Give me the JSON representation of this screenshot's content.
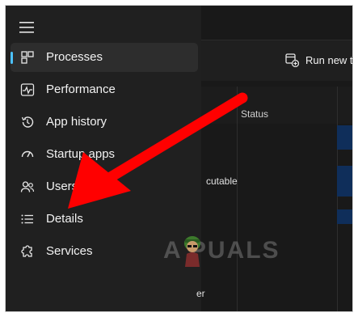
{
  "sidebar": {
    "items": [
      {
        "label": "Processes",
        "icon": "processes-icon",
        "active": true
      },
      {
        "label": "Performance",
        "icon": "performance-icon"
      },
      {
        "label": "App history",
        "icon": "history-icon"
      },
      {
        "label": "Startup apps",
        "icon": "gauge-icon"
      },
      {
        "label": "Users",
        "icon": "users-icon"
      },
      {
        "label": "Details",
        "icon": "list-icon"
      },
      {
        "label": "Services",
        "icon": "puzzle-icon"
      }
    ]
  },
  "toolbar": {
    "run_task_label": "Run new t"
  },
  "table": {
    "status_header": "Status",
    "row_fragment_1": "cutable",
    "row_fragment_2": "er"
  },
  "watermark": {
    "text": "A  PUALS"
  },
  "colors": {
    "accent": "#4cc2ff",
    "arrow": "#ff0000",
    "selection": "#0f2e5a"
  }
}
